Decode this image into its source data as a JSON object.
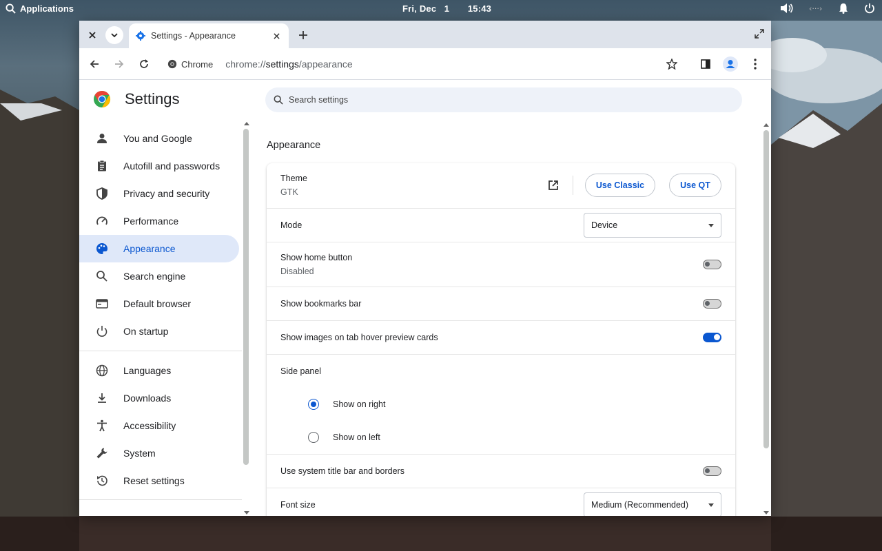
{
  "desktop": {
    "apps_label": "Applications",
    "clock": "Fri, Dec   1       15:43"
  },
  "browser": {
    "tab_title": "Settings - Appearance",
    "chip_label": "Chrome",
    "url_scheme": "chrome://",
    "url_host": "settings",
    "url_path": "/appearance"
  },
  "settings": {
    "title": "Settings",
    "search_placeholder": "Search settings",
    "nav": [
      {
        "label": "You and Google",
        "icon": "person-icon"
      },
      {
        "label": "Autofill and passwords",
        "icon": "clipboard-icon"
      },
      {
        "label": "Privacy and security",
        "icon": "shield-icon"
      },
      {
        "label": "Performance",
        "icon": "speedometer-icon"
      },
      {
        "label": "Appearance",
        "icon": "palette-icon"
      },
      {
        "label": "Search engine",
        "icon": "search-icon"
      },
      {
        "label": "Default browser",
        "icon": "browser-icon"
      },
      {
        "label": "On startup",
        "icon": "power-icon"
      },
      {
        "label": "Languages",
        "icon": "globe-icon"
      },
      {
        "label": "Downloads",
        "icon": "download-icon"
      },
      {
        "label": "Accessibility",
        "icon": "accessibility-icon"
      },
      {
        "label": "System",
        "icon": "wrench-icon"
      },
      {
        "label": "Reset settings",
        "icon": "history-icon"
      }
    ],
    "section_title": "Appearance",
    "theme": {
      "label": "Theme",
      "value": "GTK",
      "classic_btn": "Use Classic",
      "qt_btn": "Use QT"
    },
    "mode": {
      "label": "Mode",
      "value": "Device"
    },
    "home_button": {
      "label": "Show home button",
      "value": "Disabled",
      "enabled": false
    },
    "bookmarks_bar": {
      "label": "Show bookmarks bar",
      "enabled": false
    },
    "hover_cards": {
      "label": "Show images on tab hover preview cards",
      "enabled": true
    },
    "side_panel": {
      "label": "Side panel",
      "right": "Show on right",
      "left": "Show on left",
      "selected": "right"
    },
    "title_bar": {
      "label": "Use system title bar and borders",
      "enabled": false
    },
    "font_size": {
      "label": "Font size",
      "value": "Medium (Recommended)"
    },
    "accent_color": "#0b57d0"
  }
}
